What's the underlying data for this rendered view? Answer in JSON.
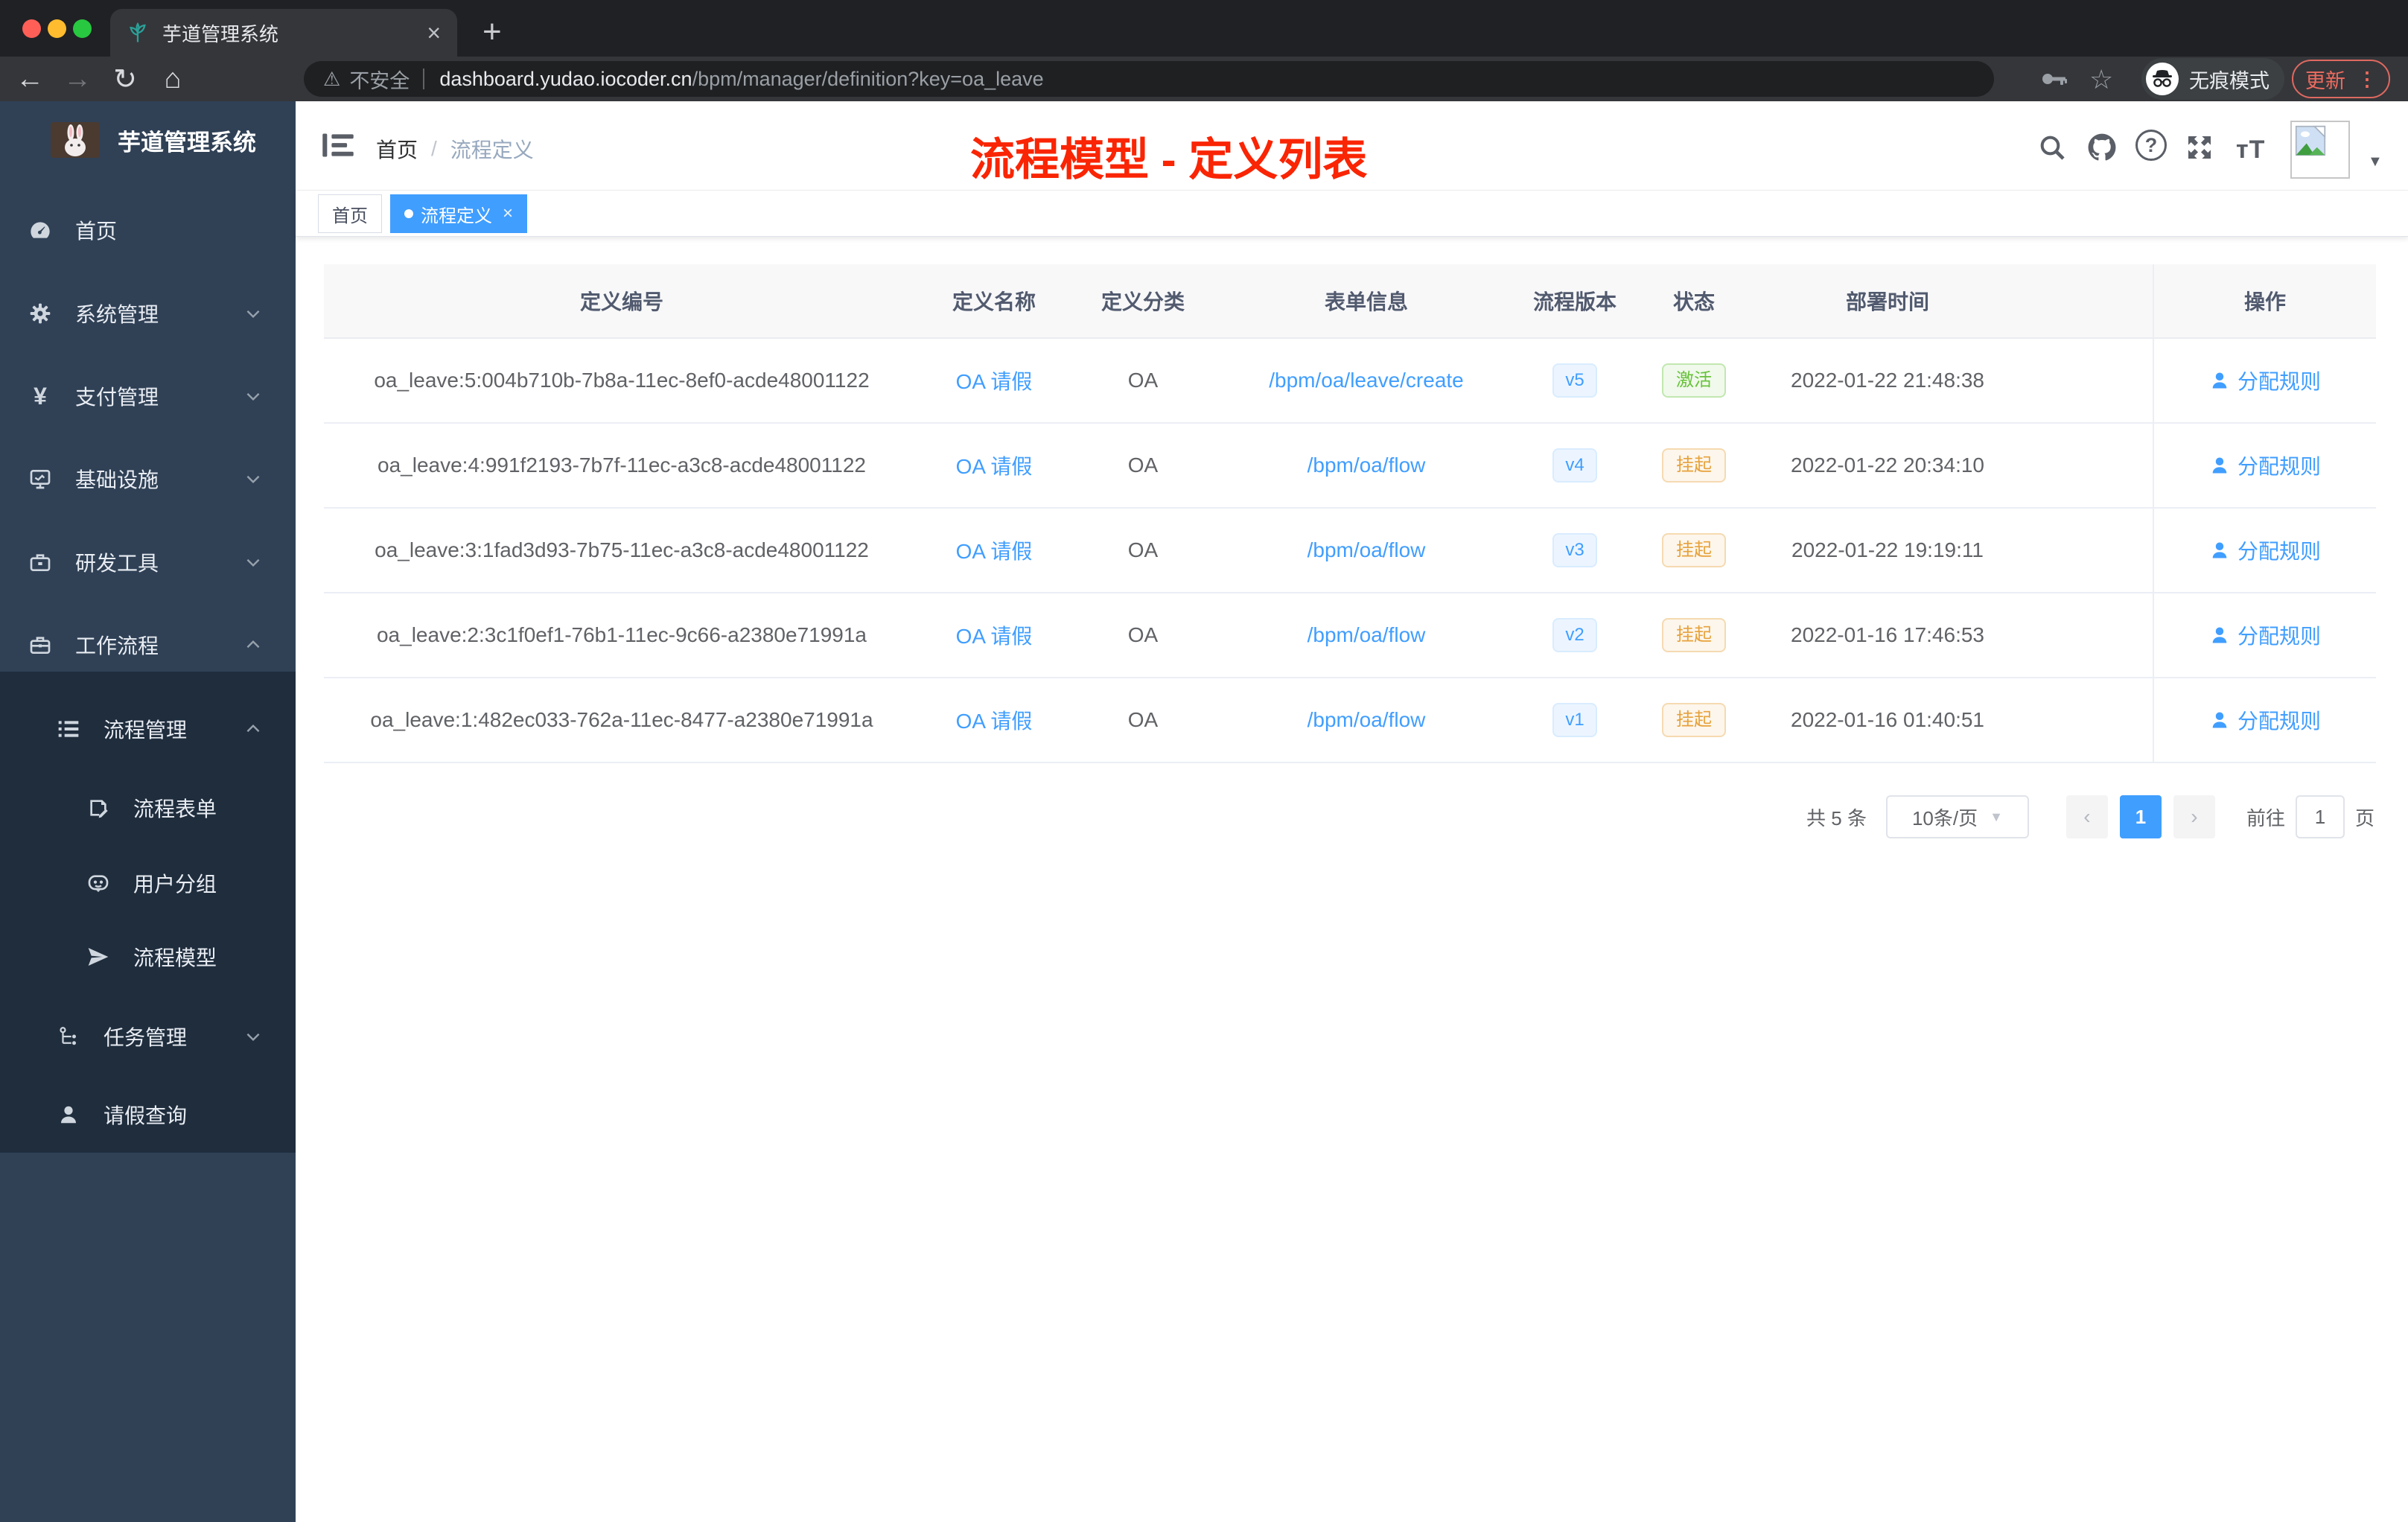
{
  "browser": {
    "tab_title": "芋道管理系统",
    "security_label": "不安全",
    "url_host": "dashboard.yudao.iocoder.cn",
    "url_path": "/bpm/manager/definition?key=oa_leave",
    "incognito_label": "无痕模式",
    "update_label": "更新"
  },
  "sidebar": {
    "app_title": "芋道管理系统",
    "items": [
      {
        "label": "首页",
        "icon": "dashboard-icon"
      },
      {
        "label": "系统管理",
        "icon": "gear-icon"
      },
      {
        "label": "支付管理",
        "icon": "yen-icon"
      },
      {
        "label": "基础设施",
        "icon": "monitor-icon"
      },
      {
        "label": "研发工具",
        "icon": "toolbox-icon"
      },
      {
        "label": "工作流程",
        "icon": "briefcase-icon"
      }
    ],
    "submenu_items": [
      {
        "label": "流程管理",
        "icon": "list-icon"
      },
      {
        "label": "流程表单",
        "icon": "form-icon"
      },
      {
        "label": "用户分组",
        "icon": "group-icon"
      },
      {
        "label": "流程模型",
        "icon": "send-icon"
      },
      {
        "label": "任务管理",
        "icon": "tree-icon"
      },
      {
        "label": "请假查询",
        "icon": "user-icon"
      }
    ]
  },
  "header": {
    "breadcrumb_home": "首页",
    "breadcrumb_separator": "/",
    "breadcrumb_current": "流程定义",
    "annotation_title": "流程模型 - 定义列表"
  },
  "tags": {
    "home": "首页",
    "active": "流程定义"
  },
  "table": {
    "columns": {
      "id": "定义编号",
      "name": "定义名称",
      "category": "定义分类",
      "form": "表单信息",
      "version": "流程版本",
      "status": "状态",
      "deploy_time": "部署时间",
      "action": "操作"
    },
    "rows": [
      {
        "id": "oa_leave:5:004b710b-7b8a-11ec-8ef0-acde48001122",
        "name": "OA 请假",
        "category": "OA",
        "form": "/bpm/oa/leave/create",
        "version": "v5",
        "status": "激活",
        "deploy_time": "2022-01-22 21:48:38",
        "action": "分配规则"
      },
      {
        "id": "oa_leave:4:991f2193-7b7f-11ec-a3c8-acde48001122",
        "name": "OA 请假",
        "category": "OA",
        "form": "/bpm/oa/flow",
        "version": "v4",
        "status": "挂起",
        "deploy_time": "2022-01-22 20:34:10",
        "action": "分配规则"
      },
      {
        "id": "oa_leave:3:1fad3d93-7b75-11ec-a3c8-acde48001122",
        "name": "OA 请假",
        "category": "OA",
        "form": "/bpm/oa/flow",
        "version": "v3",
        "status": "挂起",
        "deploy_time": "2022-01-22 19:19:11",
        "action": "分配规则"
      },
      {
        "id": "oa_leave:2:3c1f0ef1-76b1-11ec-9c66-a2380e71991a",
        "name": "OA 请假",
        "category": "OA",
        "form": "/bpm/oa/flow",
        "version": "v2",
        "status": "挂起",
        "deploy_time": "2022-01-16 17:46:53",
        "action": "分配规则"
      },
      {
        "id": "oa_leave:1:482ec033-762a-11ec-8477-a2380e71991a",
        "name": "OA 请假",
        "category": "OA",
        "form": "/bpm/oa/flow",
        "version": "v1",
        "status": "挂起",
        "deploy_time": "2022-01-16 01:40:51",
        "action": "分配规则"
      }
    ]
  },
  "pagination": {
    "total_label": "共 5 条",
    "page_size": "10条/页",
    "current_page": "1",
    "goto_label": "前往",
    "goto_value": "1",
    "page_unit": "页"
  },
  "colors": {
    "accent": "#409eff",
    "status_active": "#67c23a",
    "status_suspended": "#e6a23c",
    "annotation_red": "#f92504",
    "sidebar_bg": "#304156",
    "submenu_bg": "#1f2d3d"
  }
}
